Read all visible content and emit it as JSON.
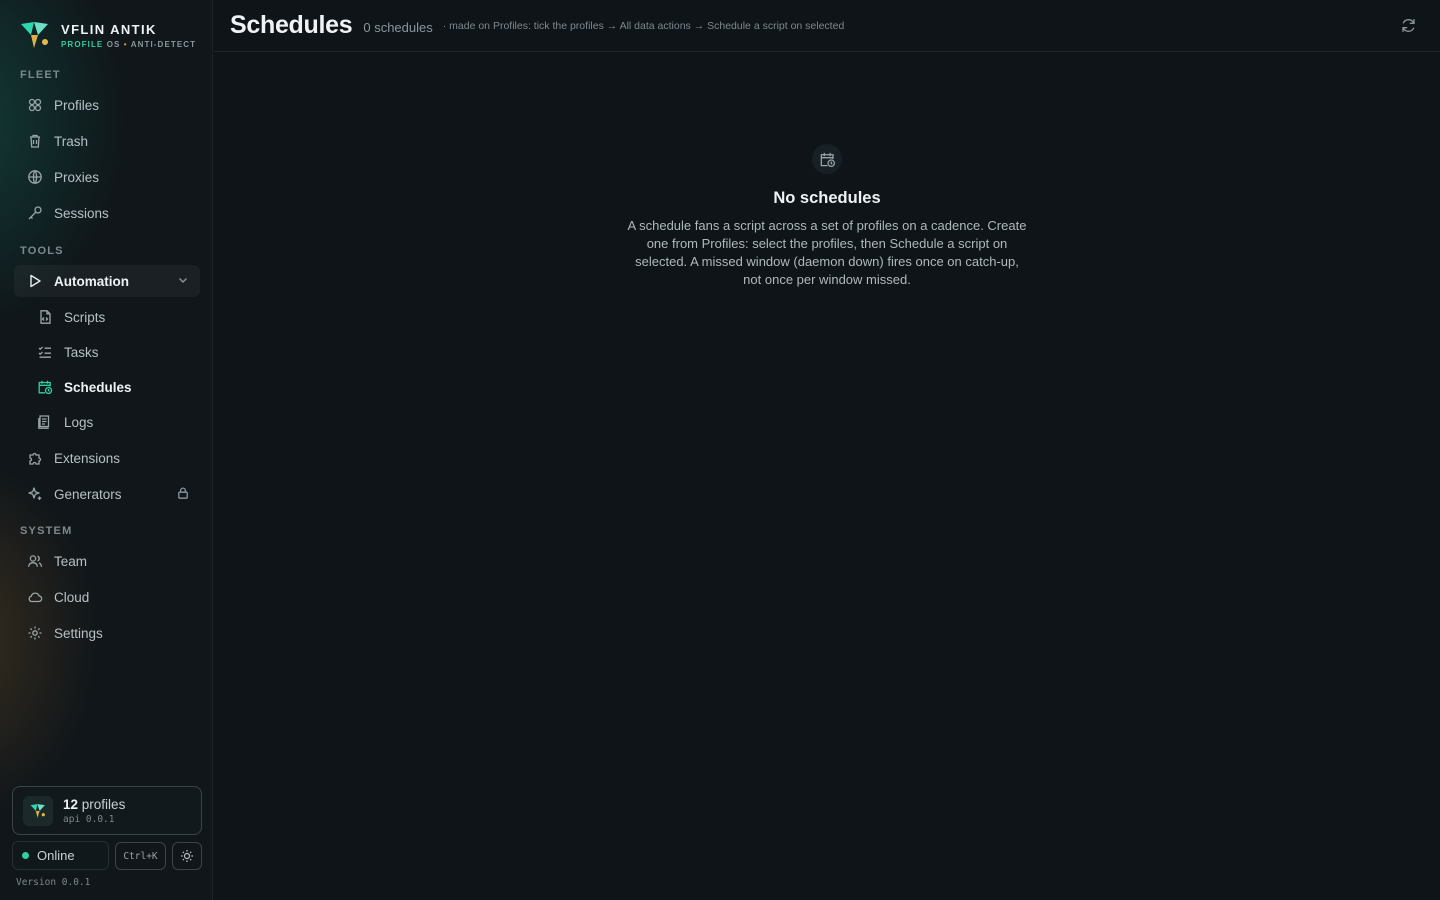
{
  "brand": {
    "name": "VFLIN ANTIK",
    "tag_primary": "PROFILE",
    "tag_secondary": "OS",
    "tag_separator": "•",
    "tag_tail": "ANTI-DETECT"
  },
  "sidebar": {
    "sections": {
      "fleet": "FLEET",
      "tools": "TOOLS",
      "system": "SYSTEM"
    },
    "fleet_items": [
      {
        "label": "Profiles",
        "icon": "profiles-icon"
      },
      {
        "label": "Trash",
        "icon": "trash-icon"
      },
      {
        "label": "Proxies",
        "icon": "globe-icon"
      },
      {
        "label": "Sessions",
        "icon": "key-icon"
      }
    ],
    "automation": {
      "label": "Automation",
      "icon": "play-icon",
      "expanded": true
    },
    "automation_children": [
      {
        "label": "Scripts",
        "icon": "script-icon"
      },
      {
        "label": "Tasks",
        "icon": "tasks-icon"
      },
      {
        "label": "Schedules",
        "icon": "calendar-clock-icon",
        "active": true
      },
      {
        "label": "Logs",
        "icon": "logs-icon"
      }
    ],
    "tools_items": [
      {
        "label": "Extensions",
        "icon": "puzzle-icon"
      },
      {
        "label": "Generators",
        "icon": "sparkle-icon",
        "locked": true
      }
    ],
    "system_items": [
      {
        "label": "Team",
        "icon": "team-icon"
      },
      {
        "label": "Cloud",
        "icon": "cloud-icon"
      },
      {
        "label": "Settings",
        "icon": "gear-icon"
      }
    ]
  },
  "footer": {
    "profiles_count": "12",
    "profiles_word": "profiles",
    "api_version": "api 0.0.1",
    "status": "Online",
    "shortcut": "Ctrl+K",
    "version": "Version 0.0.1"
  },
  "header": {
    "title": "Schedules",
    "count": "0 schedules",
    "hint": "· made on Profiles: tick the profiles → All data actions → Schedule a script on selected"
  },
  "empty_state": {
    "title": "No schedules",
    "body": "A schedule fans a script across a set of profiles on a cadence. Create one from Profiles: select the profiles, then Schedule a script on selected. A missed window (daemon down) fires once on catch-up, not once per window missed."
  },
  "colors": {
    "accent": "#2fcf9f",
    "accent_secondary": "#d49a2a",
    "background": "#0f1418",
    "sidebar": "#10161a"
  }
}
